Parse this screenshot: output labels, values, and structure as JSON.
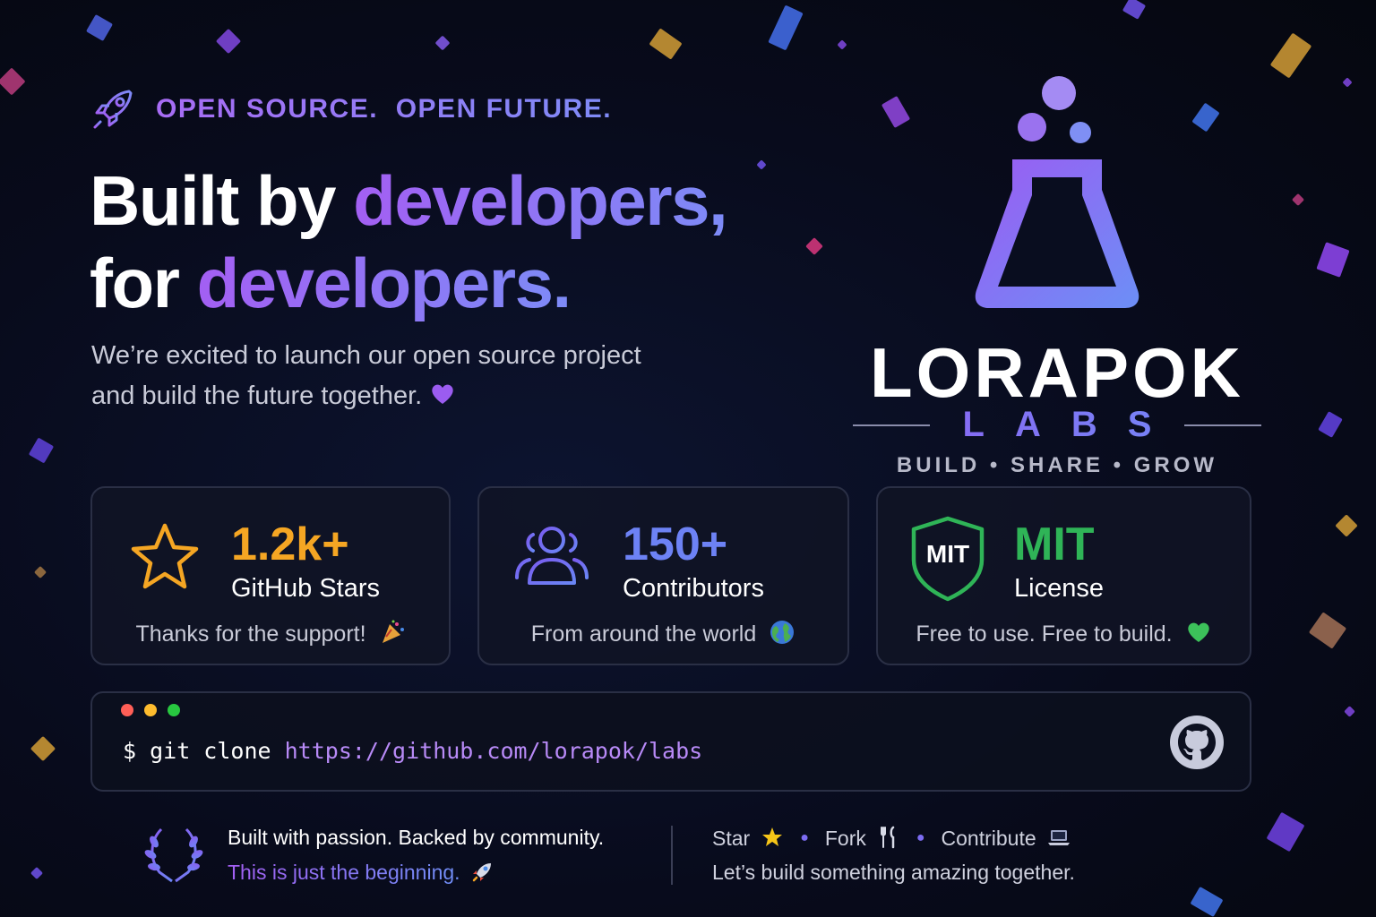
{
  "eyebrow": {
    "icon": "rocket-icon",
    "text": "OPEN SOURCE.  OPEN FUTURE."
  },
  "headline": {
    "line1_plain": "Built by ",
    "line1_accent": "developers,",
    "line2_plain": "for ",
    "line2_accent": "developers."
  },
  "subtitle": {
    "line1": "We’re excited to launch our open source project",
    "line2": "and build the future together.",
    "emoji": "purple-heart-icon"
  },
  "brand": {
    "logo": "flask-icon",
    "name": "LORAPOK",
    "sub": "LABS",
    "tagline": "BUILD • SHARE • GROW"
  },
  "stats": [
    {
      "icon": "star-icon",
      "value": "1.2k+",
      "label": "GitHub Stars",
      "note": "Thanks for the support!",
      "note_emoji": "party-popper-icon",
      "color": "#f5a623"
    },
    {
      "icon": "users-icon",
      "value": "150+",
      "label": "Contributors",
      "note": "From around the world",
      "note_emoji": "globe-icon",
      "color": "#6d7cf5"
    },
    {
      "icon": "shield-icon",
      "badge": "MIT",
      "value": "MIT",
      "label": "License",
      "note": "Free to use. Free to build.",
      "note_emoji": "green-heart-icon",
      "color": "#2fb457"
    }
  ],
  "terminal": {
    "prompt": "$ git clone ",
    "url": "https://github.com/lorapok/labs",
    "icon": "github-icon"
  },
  "footer": {
    "left_line1": "Built with passion. Backed by community.",
    "left_line2": "This is just the beginning.",
    "left_icon": "laurel-icon",
    "left_emoji": "rocket-icon",
    "actions": [
      {
        "label": "Star",
        "icon": "star-emoji-icon"
      },
      {
        "label": "Fork",
        "icon": "fork-knife-icon"
      },
      {
        "label": "Contribute",
        "icon": "laptop-icon"
      }
    ],
    "right_line2": "Let’s build something amazing together."
  },
  "colors": {
    "accent_purple": "#a35ff3",
    "accent_blue": "#7d8bf7",
    "star": "#f5a623",
    "green": "#2fb457"
  }
}
